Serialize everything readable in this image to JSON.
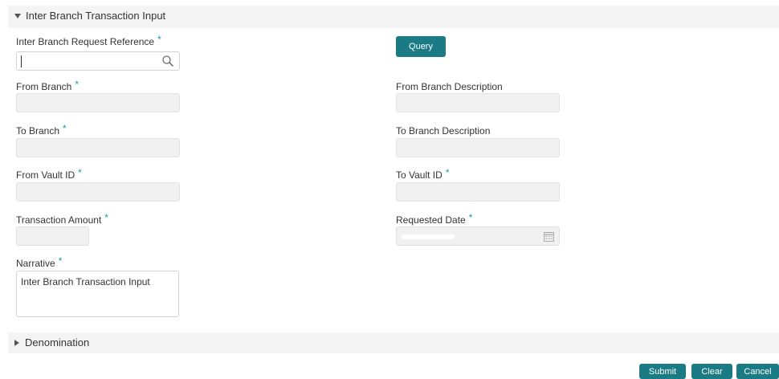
{
  "main_section": {
    "title": "Inter Branch Transaction Input",
    "fields": {
      "request_reference": {
        "label": "Inter Branch Request Reference",
        "value": ""
      },
      "from_branch": {
        "label": "From Branch",
        "value": ""
      },
      "from_branch_desc": {
        "label": "From Branch Description",
        "value": ""
      },
      "to_branch": {
        "label": "To Branch",
        "value": ""
      },
      "to_branch_desc": {
        "label": "To Branch Description",
        "value": ""
      },
      "from_vault": {
        "label": "From Vault ID",
        "value": ""
      },
      "to_vault": {
        "label": "To Vault ID",
        "value": ""
      },
      "txn_amount": {
        "label": "Transaction Amount",
        "value": ""
      },
      "requested_date": {
        "label": "Requested Date",
        "value": ""
      },
      "narrative": {
        "label": "Narrative",
        "value": "Inter Branch Transaction Input"
      }
    },
    "required_marker": "*",
    "query_label": "Query"
  },
  "denomination_section": {
    "title": "Denomination"
  },
  "footer": {
    "submit_label": "Submit",
    "clear_label": "Clear",
    "cancel_label": "Cancel"
  },
  "colors": {
    "accent": "#1b7b84",
    "required": "#1b9aaa",
    "panel_bg": "#f4f4f4",
    "field_bg": "#f1f1f1"
  },
  "icons": {
    "search": "search-icon",
    "calendar": "calendar-icon",
    "expand": "triangle-down-icon",
    "collapse": "triangle-right-icon"
  }
}
